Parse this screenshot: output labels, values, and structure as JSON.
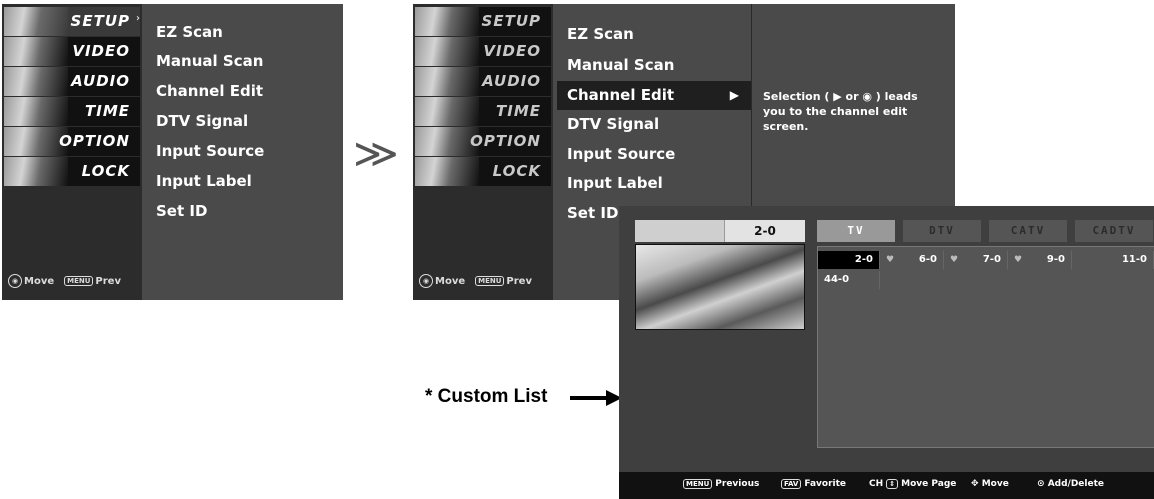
{
  "sidebar": {
    "items": [
      {
        "label": "SETUP"
      },
      {
        "label": "VIDEO"
      },
      {
        "label": "AUDIO"
      },
      {
        "label": "TIME"
      },
      {
        "label": "OPTION"
      },
      {
        "label": "LOCK"
      }
    ],
    "hint_move": "Move",
    "hint_menu_key": "MENU",
    "hint_prev": "Prev"
  },
  "menu": {
    "items": [
      {
        "label": "EZ Scan"
      },
      {
        "label": "Manual Scan"
      },
      {
        "label": "Channel Edit"
      },
      {
        "label": "DTV Signal"
      },
      {
        "label": "Input Source"
      },
      {
        "label": "Input Label"
      },
      {
        "label": "Set ID"
      }
    ],
    "selected_arrow": "▶"
  },
  "info": {
    "line1": "Selection ( ▶ or ◉ ) leads",
    "line2": "you to the channel edit",
    "line3": "screen."
  },
  "transition_symbol": "≫",
  "custom_list_label": "* Custom List",
  "channel_edit": {
    "current_channel": "2-0",
    "tabs": [
      {
        "label": "TV"
      },
      {
        "label": "DTV"
      },
      {
        "label": "CATV"
      },
      {
        "label": "CADTV"
      }
    ],
    "channels_row1": [
      "2-0",
      "6-0",
      "7-0",
      "9-0",
      "11-0"
    ],
    "channels_row2": [
      "44-0"
    ],
    "footer": {
      "menu_key": "MENU",
      "previous": "Previous",
      "fav_key": "FAV",
      "favorite": "Favorite",
      "ch_key": "CH",
      "move_page": "Move Page",
      "move": "Move",
      "add_delete": "Add/Delete"
    }
  }
}
